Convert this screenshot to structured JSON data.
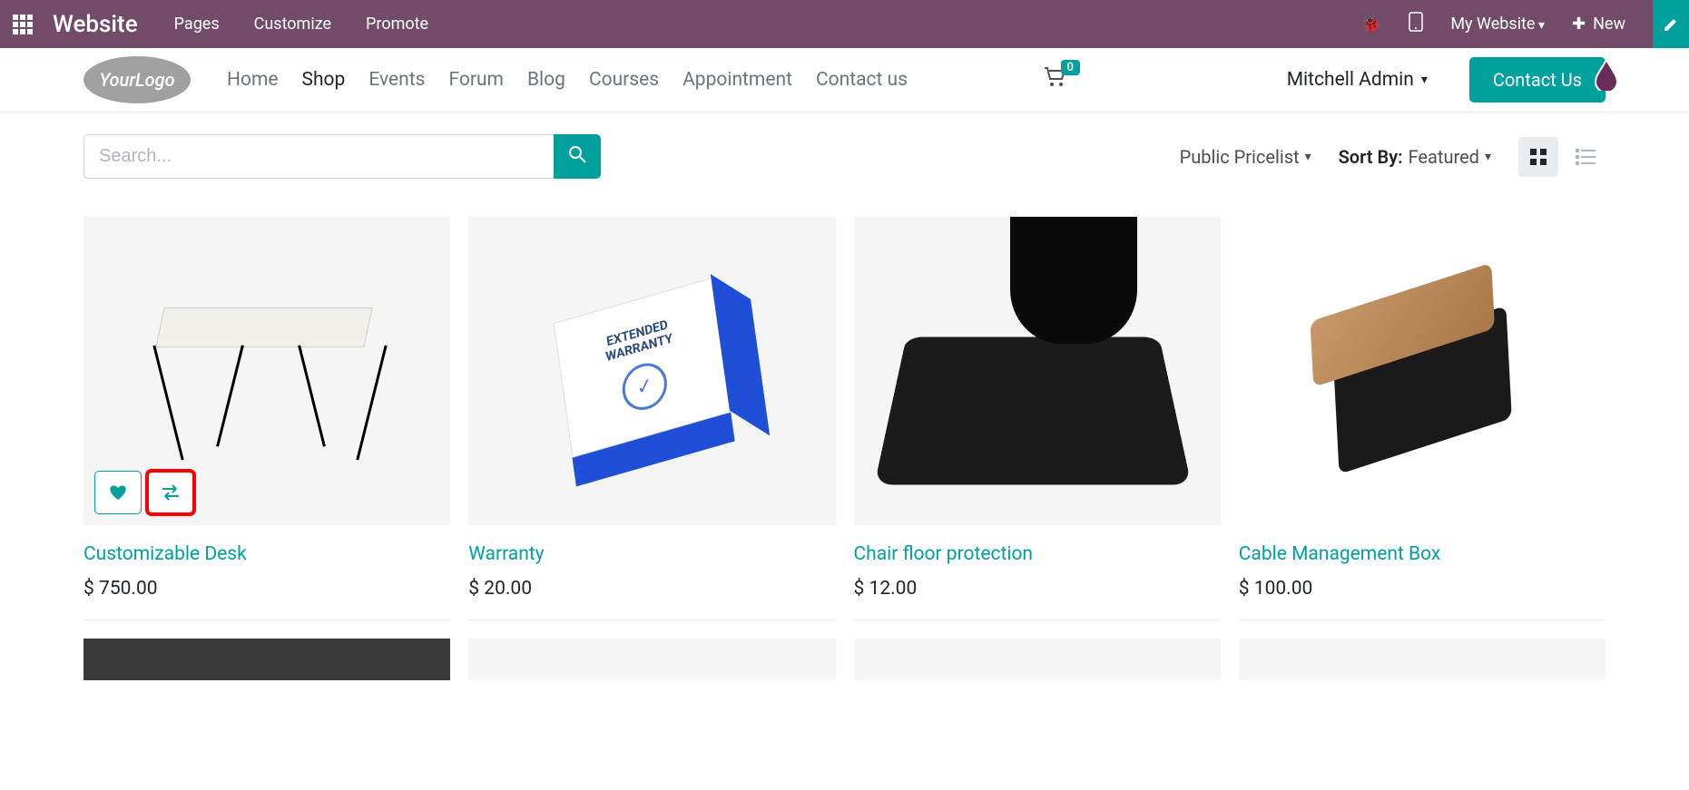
{
  "topbar": {
    "brand": "Website",
    "nav": [
      "Pages",
      "Customize",
      "Promote"
    ],
    "my_website": "My Website",
    "new_label": "New"
  },
  "header": {
    "logo_text": "YourLogo",
    "nav": [
      {
        "label": "Home",
        "active": false
      },
      {
        "label": "Shop",
        "active": true
      },
      {
        "label": "Events",
        "active": false
      },
      {
        "label": "Forum",
        "active": false
      },
      {
        "label": "Blog",
        "active": false
      },
      {
        "label": "Courses",
        "active": false
      },
      {
        "label": "Appointment",
        "active": false
      },
      {
        "label": "Contact us",
        "active": false
      }
    ],
    "cart_count": "0",
    "user_name": "Mitchell Admin",
    "contact_us": "Contact Us"
  },
  "controls": {
    "search_placeholder": "Search...",
    "pricelist": "Public Pricelist",
    "sort_label": "Sort By:",
    "sort_value": "Featured"
  },
  "products": [
    {
      "title": "Customizable Desk",
      "price": "$ 750.00",
      "hovered": true
    },
    {
      "title": "Warranty",
      "price": "$ 20.00",
      "hovered": false
    },
    {
      "title": "Chair floor protection",
      "price": "$ 12.00",
      "hovered": false
    },
    {
      "title": "Cable Management Box",
      "price": "$ 100.00",
      "hovered": false
    }
  ],
  "colors": {
    "primary": "#00a09d",
    "topbar": "#714b67"
  }
}
